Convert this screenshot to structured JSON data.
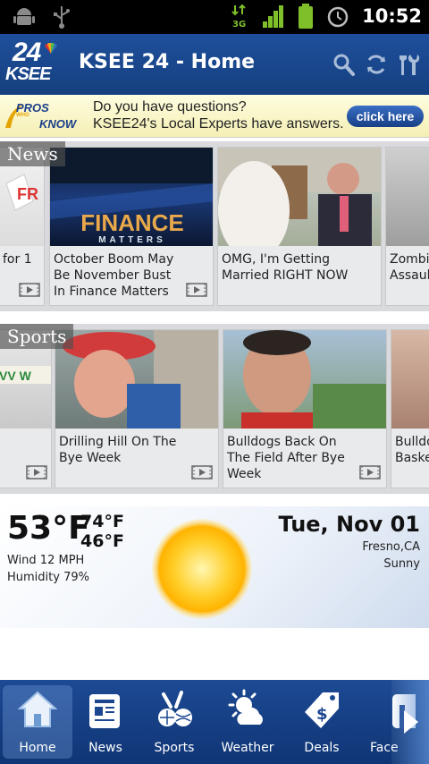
{
  "status_bar": {
    "time": "10:52",
    "network": "3G",
    "icons": [
      "android-debug-icon",
      "usb-icon",
      "3g-signal-icon",
      "signal-bars-icon",
      "battery-icon",
      "alarm-icon"
    ]
  },
  "header": {
    "logo_top": "24",
    "logo_bottom": "KSEE",
    "title": "KSEE 24 - Home",
    "actions": [
      "search-icon",
      "refresh-icon",
      "tools-icon"
    ]
  },
  "ad": {
    "logo_line1": "PROS",
    "logo_line2": "WHO",
    "logo_line3": "KNOW",
    "line1": "Do you have questions?",
    "line2": "KSEE24's Local Experts have answers.",
    "button": "click here"
  },
  "news": {
    "label": "News",
    "items": [
      {
        "caption": "for 1"
      },
      {
        "caption": "October Boom May Be November Bust In Finance Matters",
        "thumb_text_1": "FINANCE",
        "thumb_text_2": "MATTERS"
      },
      {
        "caption": "OMG, I'm Getting Married RIGHT NOW"
      },
      {
        "caption": "Zombi Assaul"
      }
    ]
  },
  "sports": {
    "label": "Sports",
    "items": [
      {
        "caption": ""
      },
      {
        "caption": "Drilling Hill On The Bye Week"
      },
      {
        "caption": "Bulldogs Back On The Field After Bye Week"
      },
      {
        "caption": "Bulldo Baske"
      }
    ]
  },
  "weather": {
    "current_temp": "53°F",
    "high": "74°F",
    "low": "46°F",
    "wind": "Wind 12 MPH",
    "humidity": "Humidity 79%",
    "date": "Tue, Nov 01",
    "city": "Fresno,CA",
    "condition": "Sunny",
    "icon": "sun-icon"
  },
  "nav": {
    "items": [
      {
        "label": "Home",
        "icon": "home-icon",
        "active": true
      },
      {
        "label": "News",
        "icon": "newspaper-icon",
        "active": false
      },
      {
        "label": "Sports",
        "icon": "sports-icon",
        "active": false
      },
      {
        "label": "Weather",
        "icon": "weather-icon",
        "active": false
      },
      {
        "label": "Deals",
        "icon": "deals-tag-icon",
        "active": false
      },
      {
        "label": "Face",
        "icon": "facebook-icon",
        "active": false
      }
    ],
    "more": "arrow-right-icon"
  },
  "colors": {
    "header_blue": "#1a4a94",
    "nav_blue": "#15407f",
    "ad_button": "#1f4f9c",
    "section_bg": "#d9dadd",
    "sun": "#ffc21a"
  }
}
